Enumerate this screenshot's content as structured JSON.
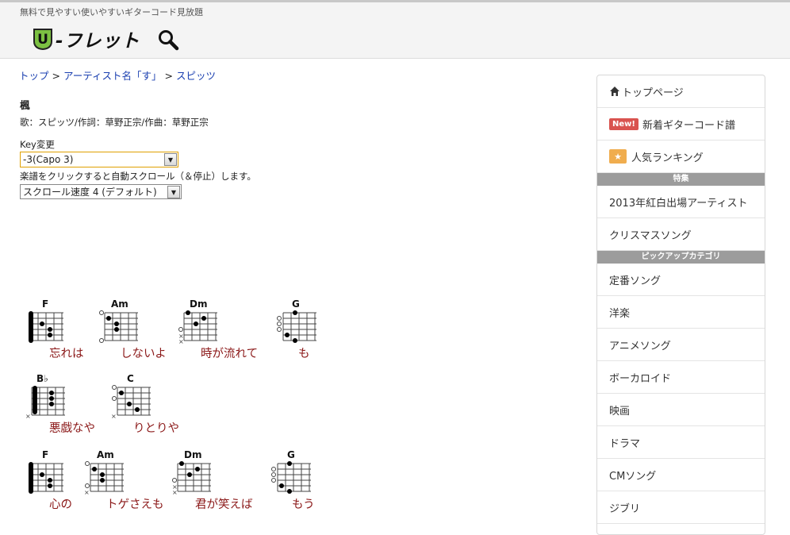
{
  "header": {
    "tagline": "無料で見やすい使いやすいギターコード見放題",
    "logo_text": "-フレット",
    "logo_badge": "U"
  },
  "breadcrumb": {
    "items": [
      "トップ",
      "アーティスト名「す」",
      "スピッツ"
    ],
    "separator": ">"
  },
  "song": {
    "title": "楓",
    "credit": "歌：スピッツ/作詞：草野正宗/作曲：草野正宗"
  },
  "controls": {
    "key_label": "Key変更",
    "key_value": "-3(Capo 3)",
    "scroll_note": "楽譜をクリックすると自動スクロール（＆停止）します。",
    "speed_value": "スクロール速度 4 (デフォルト)"
  },
  "sheet": {
    "rows": [
      {
        "chords": [
          "F",
          "Am",
          "Dm",
          "G"
        ],
        "lyrics": [
          "忘れは",
          "しないよ",
          "時が流れて",
          "も"
        ]
      },
      {
        "chords": [
          "B♭",
          "C"
        ],
        "lyrics": [
          "悪戯なや",
          "りとりや"
        ]
      },
      {
        "chords": [
          "F",
          "Am",
          "Dm",
          "G"
        ],
        "lyrics": [
          "心の",
          "トゲさえも",
          "君が笑えば",
          "もう"
        ]
      }
    ]
  },
  "sidebar": {
    "top_page": "トップページ",
    "new_badge": "New!",
    "new_chords": "新着ギターコード譜",
    "ranking": "人気ランキング",
    "special_header": "特集",
    "special_items": [
      "2013年紅白出場アーティスト",
      "クリスマスソング"
    ],
    "pickup_header": "ピックアップカテゴリ",
    "pickup_items": [
      "定番ソング",
      "洋楽",
      "アニメソング",
      "ボーカロイド",
      "映画",
      "ドラマ",
      "CMソング",
      "ジブリ"
    ]
  },
  "colors": {
    "lyric": "#8b1818",
    "link": "#1a3fb0",
    "new_badge": "#d9534f",
    "star_badge": "#f0ad4e",
    "section_header": "#9c9c9c"
  }
}
